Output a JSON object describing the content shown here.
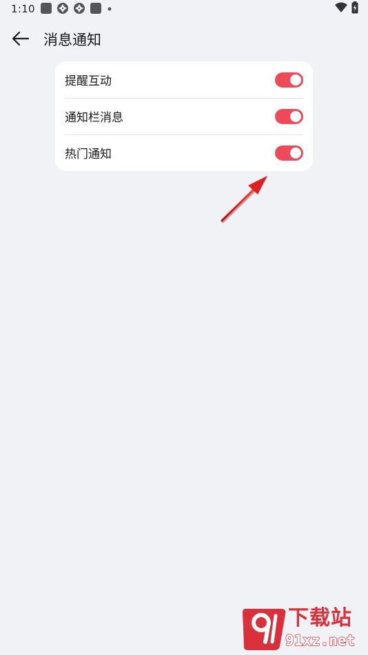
{
  "status_bar": {
    "time": "1:10",
    "notification_icons": [
      "app-square-icon",
      "sync-icon",
      "sync-icon",
      "app-square-icon",
      "dot-icon"
    ],
    "system_icons": [
      "wifi-icon",
      "battery-charging-icon"
    ]
  },
  "app_bar": {
    "back_icon": "arrow-left-icon",
    "title": "消息通知"
  },
  "settings": {
    "items": [
      {
        "label": "提醒互动",
        "enabled": true
      },
      {
        "label": "通知栏消息",
        "enabled": true
      },
      {
        "label": "热门通知",
        "enabled": true
      }
    ]
  },
  "colors": {
    "background": "#f1f2f6",
    "card": "#ffffff",
    "accent": "#ef4a5a",
    "annotation_arrow": "#e02020",
    "watermark": "#d9303c"
  },
  "watermark": {
    "badge_text": "9",
    "text_top": "下载站",
    "text_bottom": "91xz.net"
  }
}
